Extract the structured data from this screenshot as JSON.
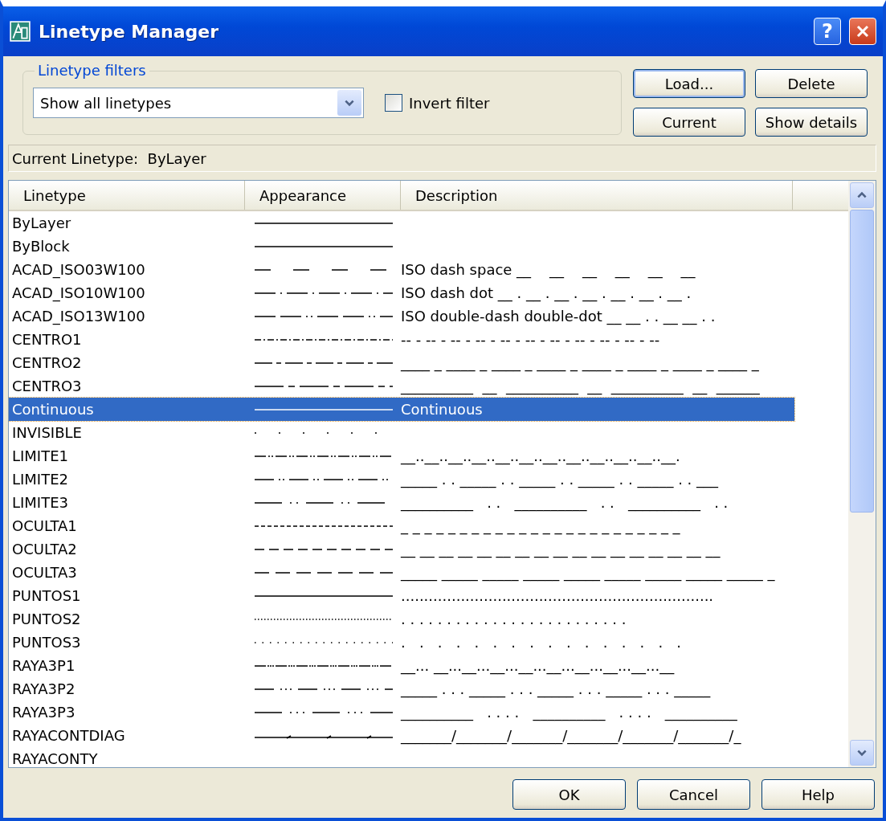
{
  "window": {
    "title": "Linetype Manager",
    "help_button": "?"
  },
  "filters": {
    "legend": "Linetype filters",
    "dropdown": "Show all linetypes",
    "invert": {
      "label": "Invert filter",
      "checked": false
    }
  },
  "side_buttons": [
    "Load...",
    "Delete",
    "Current",
    "Show details"
  ],
  "current_linetype": {
    "label": "Current Linetype:",
    "value": "ByLayer"
  },
  "table": {
    "columns": [
      "Linetype",
      "Appearance",
      "Description"
    ],
    "rows": [
      {
        "name": "ByLayer",
        "kind": "solid",
        "selected": false
      },
      {
        "name": "ByBlock",
        "kind": "solid",
        "selected": false
      },
      {
        "name": "ACAD_ISO03W100",
        "kind": "dash-space",
        "description": "ISO dash space __    __    __    __    __    __",
        "selected": false
      },
      {
        "name": "ACAD_ISO10W100",
        "kind": "dash-dot",
        "description": "ISO dash dot __ . __ . __ . __ . __ . __ . __ .",
        "selected": false
      },
      {
        "name": "ACAD_ISO13W100",
        "kind": "double-dash-double-dot",
        "description": "ISO double-dash double-dot __ __ . . __ __ . .",
        "selected": false
      },
      {
        "name": "CENTRO1",
        "kind": "center-fine",
        "description": "-- - -- - -- - -- - -- - -- - -- - -- - -- - -- - --",
        "selected": false
      },
      {
        "name": "CENTRO2",
        "kind": "center",
        "description": "____ _ ____ _ ____ _ ____ _ ____ _ ____ _ ____ _ ____ _",
        "selected": false
      },
      {
        "name": "CENTRO3",
        "kind": "center-long",
        "description": "__________  __  __________  __  __________  __  ______",
        "selected": false
      },
      {
        "name": "Continuous",
        "kind": "solid",
        "description": "Continuous",
        "selected": true
      },
      {
        "name": "INVISIBLE",
        "kind": "sparse-dots",
        "selected": false
      },
      {
        "name": "LIMITE1",
        "kind": "dash-double-dot-fine",
        "description": "__..__..__..__..__..__..__..__..__..__..__..__.",
        "selected": false
      },
      {
        "name": "LIMITE2",
        "kind": "dash-double-dot",
        "description": "_____ . . _____ . . _____ . . _____ . . _____ . . ___",
        "selected": false
      },
      {
        "name": "LIMITE3",
        "kind": "dash-double-dot-long",
        "description": "__________   . .   __________   . .   __________   . .",
        "selected": false
      },
      {
        "name": "OCULTA1",
        "kind": "hidden-fine",
        "description": "_ _ _ _ _ _ _ _ _ _ _ _ _ _ _ _ _ _ _ _ _ _ _ _",
        "selected": false
      },
      {
        "name": "OCULTA2",
        "kind": "hidden",
        "description": "__ __ __ __ __ __ __ __ __ __ __ __ __ __ __ __ __",
        "selected": false
      },
      {
        "name": "OCULTA3",
        "kind": "hidden-long",
        "description": "_____ _____ _____ _____ _____ _____ _____ _____ _____ _",
        "selected": false
      },
      {
        "name": "PUNTOS1",
        "kind": "solid",
        "description": "....................................................................",
        "selected": false
      },
      {
        "name": "PUNTOS2",
        "kind": "dots",
        "description": ". . . . . . . . . . . . . . . . . . . . . . . . .",
        "selected": false
      },
      {
        "name": "PUNTOS3",
        "kind": "wide-dots",
        "description": ".   .   .   .   .   .   .   .   .   .   .   .   .   .   .   .",
        "selected": false
      },
      {
        "name": "RAYA3P1",
        "kind": "dash-triple-dot-fine",
        "description": "__... __...__...__...__...__...__...__...__...__",
        "selected": false
      },
      {
        "name": "RAYA3P2",
        "kind": "dash-triple-dot",
        "description": "_____ . . . _____ . . . _____ . . . _____ . . . _____",
        "selected": false
      },
      {
        "name": "RAYA3P3",
        "kind": "dash-triple-dot-long",
        "description": "__________   . . . .   __________   . . . .   __________",
        "selected": false
      },
      {
        "name": "RAYACONTDIAG",
        "kind": "diagonal",
        "description": "_______/_______/_______/_______/_______/_______/_",
        "selected": false
      },
      {
        "name": "RAYACONTY",
        "kind": "none",
        "selected": false
      }
    ]
  },
  "bottom_buttons": [
    "OK",
    "Cancel",
    "Help"
  ]
}
